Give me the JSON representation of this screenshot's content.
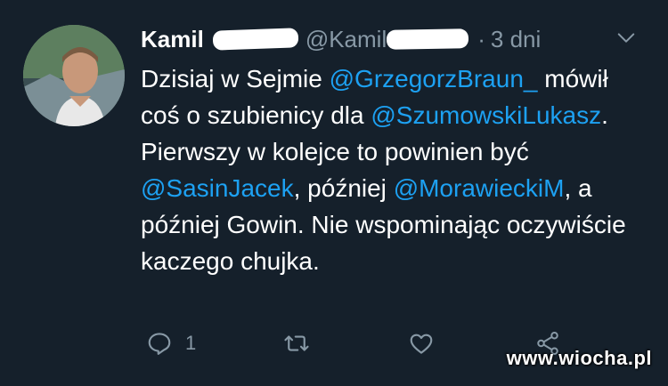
{
  "tweet": {
    "author_name": "Kamil",
    "handle": "@Kamil",
    "separator": "·",
    "time": "3 dni",
    "text": {
      "p1": "Dzisiaj w Sejmie ",
      "m1": "@GrzegorzBraun_",
      "p2": " mówił coś o szubienicy dla ",
      "m2": "@SzumowskiLukasz",
      "p3": ". Pierwszy w kolejce to powinien być ",
      "m3": "@SasinJacek",
      "p4": ", później ",
      "m4": "@MorawieckiM",
      "p5": ", a później Gowin. Nie wspominając oczywiście kaczego chujka."
    },
    "actions": {
      "reply_count": "1",
      "retweet_count": "",
      "like_count": "",
      "reply_icon": "reply-icon",
      "retweet_icon": "retweet-icon",
      "like_icon": "heart-icon",
      "share_icon": "share-icon"
    }
  },
  "watermark": "www.wiocha.pl",
  "colors": {
    "background": "#15202b",
    "text": "#ffffff",
    "muted": "#8899a6",
    "mention": "#1da1f2"
  }
}
